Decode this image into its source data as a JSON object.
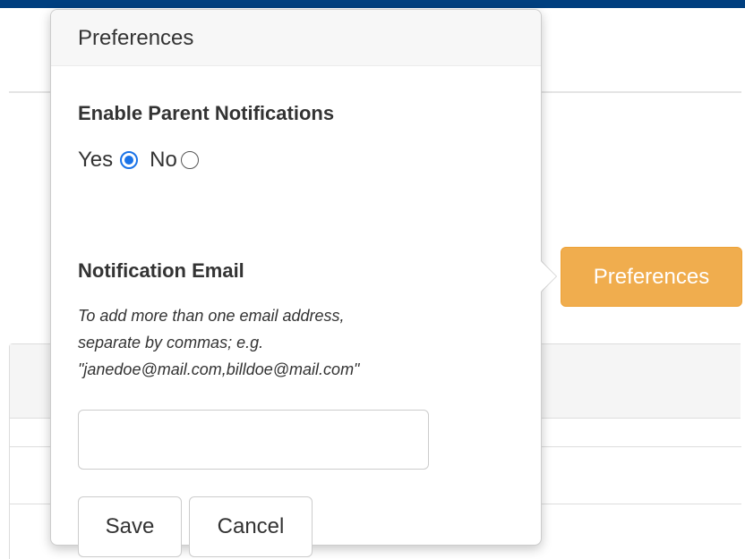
{
  "page": {
    "preferences_button_label": "Preferences",
    "accent_color": "#f0ad4e",
    "top_bar_color": "#003f7f"
  },
  "popover": {
    "title": "Preferences",
    "notifications": {
      "heading": "Enable Parent Notifications",
      "options": [
        {
          "label": "Yes",
          "selected": true
        },
        {
          "label": "No",
          "selected": false
        }
      ]
    },
    "email": {
      "heading": "Notification Email",
      "help_lines": [
        "To add more than one email address,",
        "separate by commas; e.g.",
        "\"janedoe@mail.com,billdoe@mail.com\""
      ],
      "value": "",
      "placeholder": ""
    },
    "buttons": {
      "save_label": "Save",
      "cancel_label": "Cancel"
    }
  }
}
